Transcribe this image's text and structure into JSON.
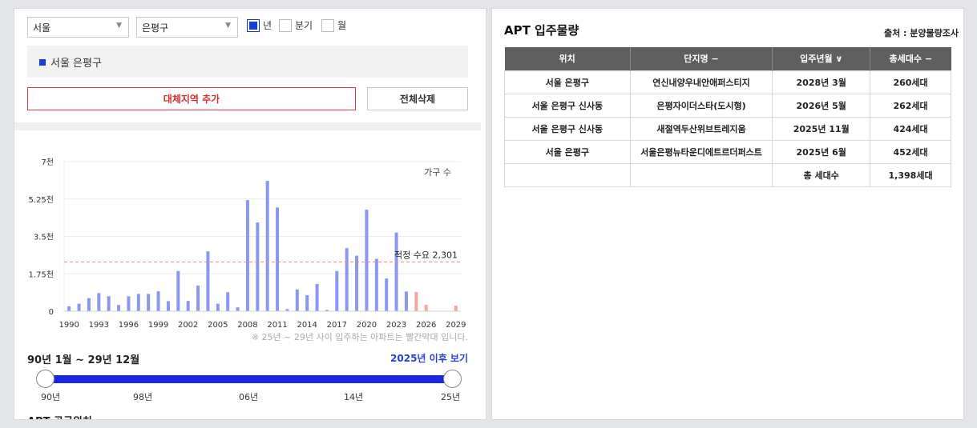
{
  "filters": {
    "city": "서울",
    "district": "은평구",
    "period_year": "년",
    "period_quarter": "분기",
    "period_month": "월"
  },
  "selected_region": "서울 은평구",
  "buttons": {
    "add_region": "대체지역 추가",
    "clear_all": "전체삭제"
  },
  "chart_data": {
    "type": "bar",
    "legend": "가구 수",
    "ylim": [
      0,
      7000
    ],
    "ytick_labels": [
      "7천",
      "5.25천",
      "3.5천",
      "1.75천",
      "0"
    ],
    "ytick_values": [
      7000,
      5250,
      3500,
      1750,
      0
    ],
    "xtick_labels": [
      "1990",
      "1993",
      "1996",
      "1999",
      "2002",
      "2005",
      "2008",
      "2011",
      "2014",
      "2017",
      "2020",
      "2023",
      "2026",
      "2029"
    ],
    "categories": [
      "1990",
      "1991",
      "1992",
      "1993",
      "1994",
      "1995",
      "1996",
      "1997",
      "1998",
      "1999",
      "2000",
      "2001",
      "2002",
      "2003",
      "2004",
      "2005",
      "2006",
      "2007",
      "2008",
      "2009",
      "2010",
      "2011",
      "2012",
      "2013",
      "2014",
      "2015",
      "2016",
      "2017",
      "2018",
      "2019",
      "2020",
      "2021",
      "2022",
      "2023",
      "2024",
      "2025",
      "2026",
      "2027",
      "2028",
      "2029"
    ],
    "values": [
      230,
      350,
      610,
      850,
      700,
      290,
      700,
      810,
      810,
      930,
      470,
      1880,
      480,
      1200,
      2800,
      350,
      890,
      180,
      5200,
      4150,
      6100,
      4850,
      100,
      1020,
      750,
      1270,
      60,
      1880,
      2950,
      2600,
      4750,
      2450,
      1530,
      3680,
      920,
      900,
      300,
      0,
      0,
      260
    ],
    "future_from": "2025",
    "colors": {
      "past": "#8b97ee",
      "future": "#f4a6a0",
      "reference": "#f08a7e"
    },
    "reference_line": {
      "value": 2301,
      "label": "적정 수요 2,301"
    },
    "grid": true
  },
  "note": "※ 25년 ~ 29년 사이 입주하는 아파트는 빨간막대 입니다.",
  "range": {
    "label": "90년 1월 ~ 29년 12월",
    "link": "2025년 이후 보기",
    "ticks": [
      "90년",
      "98년",
      "06년",
      "14년",
      "25년"
    ]
  },
  "supply_title": "APT 공급위치",
  "right": {
    "title": "APT 입주물량",
    "source": "출처 : 분양물량조사",
    "headers": [
      "위치",
      "단지명 −",
      "입주년월 ∨",
      "총세대수 −"
    ],
    "rows": [
      [
        "서울 은평구",
        "연신내양우내안애퍼스티지",
        "2028년 3월",
        "260세대"
      ],
      [
        "서울 은평구 신사동",
        "은평자이더스타(도시형)",
        "2026년 5월",
        "262세대"
      ],
      [
        "서울 은평구 신사동",
        "새절역두산위브트레지움",
        "2025년 11월",
        "424세대"
      ],
      [
        "서울 은평구",
        "서울은평뉴타운디에트르더퍼스트",
        "2025년 6월",
        "452세대"
      ]
    ],
    "total_label": "총 세대수",
    "total_value": "1,398세대"
  }
}
